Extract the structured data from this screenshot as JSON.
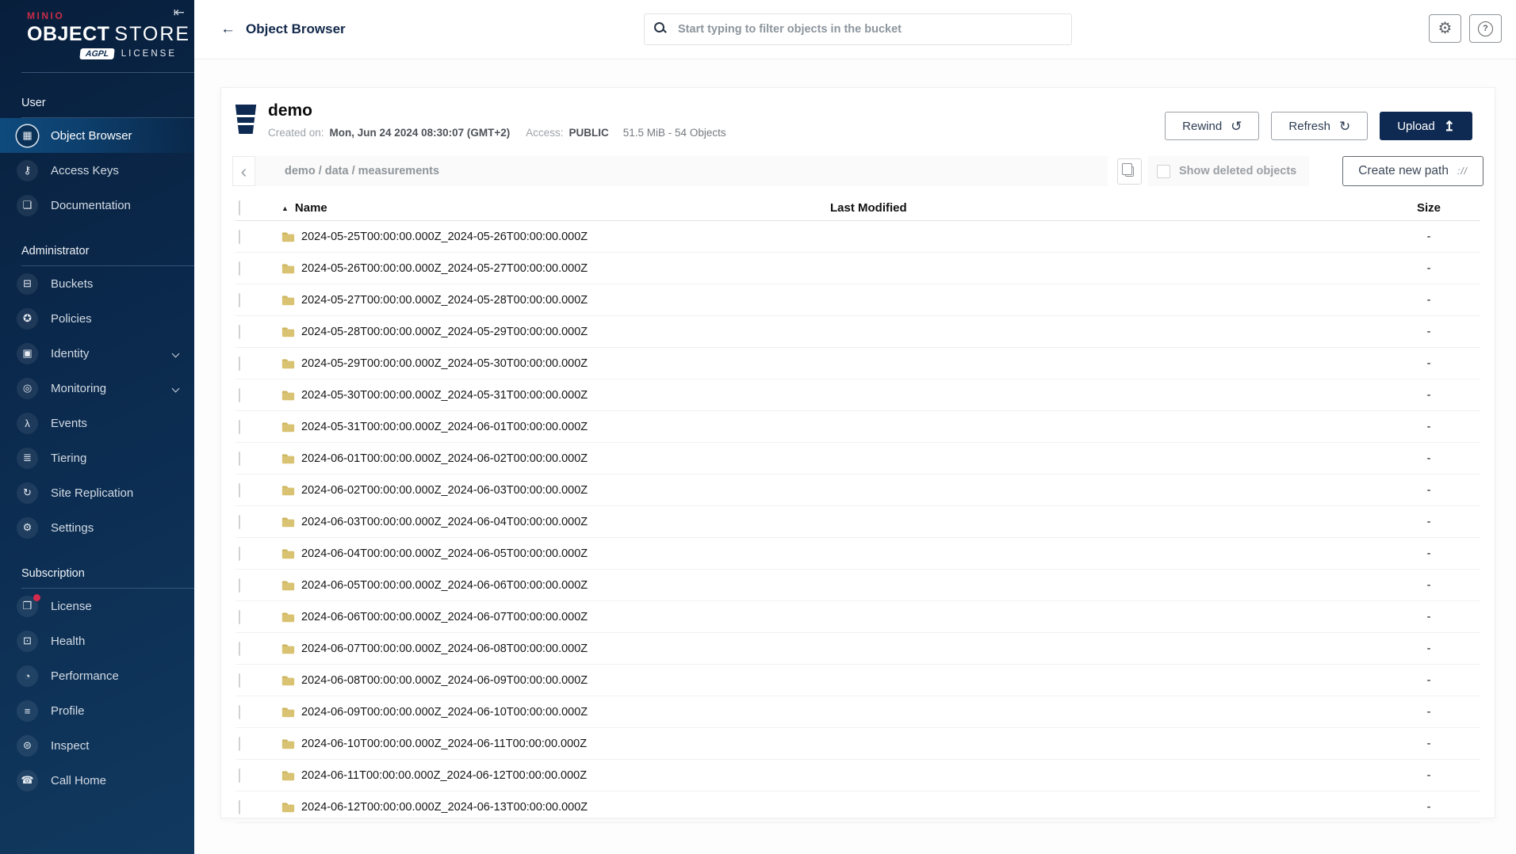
{
  "logo": {
    "brand": "MINIO",
    "word_primary": "OBJECT",
    "word_secondary": "STORE",
    "badge": "AGPL",
    "license_label": "LICENSE",
    "collapse_glyph": "⇤"
  },
  "app": {
    "header_title": "Object Browser",
    "back_glyph": "←",
    "search_placeholder": "Start typing to filter objects in the bucket",
    "gear_glyph": "⚙",
    "help_glyph": "?"
  },
  "sidebar": {
    "sections": {
      "user": {
        "label": "User",
        "items": [
          {
            "id": "sidebar-item-object-browser",
            "icon_name": "object-browser-icon",
            "glyph": "▦",
            "label": "Object Browser",
            "active": true
          },
          {
            "id": "sidebar-item-access-keys",
            "icon_name": "access-keys-icon",
            "glyph": "⚷",
            "label": "Access Keys"
          },
          {
            "id": "sidebar-item-documentation",
            "icon_name": "documentation-icon",
            "glyph": "❏",
            "label": "Documentation"
          }
        ]
      },
      "administrator": {
        "label": "Administrator",
        "items": [
          {
            "id": "sidebar-item-buckets",
            "icon_name": "buckets-icon",
            "glyph": "⊟",
            "label": "Buckets"
          },
          {
            "id": "sidebar-item-policies",
            "icon_name": "policies-icon",
            "glyph": "✪",
            "label": "Policies"
          },
          {
            "id": "sidebar-item-identity",
            "icon_name": "identity-icon",
            "glyph": "▣",
            "label": "Identity",
            "has_submenu": true
          },
          {
            "id": "sidebar-item-monitoring",
            "icon_name": "monitoring-icon",
            "glyph": "◎",
            "label": "Monitoring",
            "has_submenu": true
          },
          {
            "id": "sidebar-item-events",
            "icon_name": "events-icon",
            "glyph": "λ",
            "label": "Events"
          },
          {
            "id": "sidebar-item-tiering",
            "icon_name": "tiering-icon",
            "glyph": "≣",
            "label": "Tiering"
          },
          {
            "id": "sidebar-item-site-replication",
            "icon_name": "site-replication-icon",
            "glyph": "↻",
            "label": "Site Replication"
          },
          {
            "id": "sidebar-item-settings",
            "icon_name": "settings-icon",
            "glyph": "⚙",
            "label": "Settings"
          }
        ]
      },
      "subscription": {
        "label": "Subscription",
        "items": [
          {
            "id": "sidebar-item-license",
            "icon_name": "license-icon",
            "glyph": "❒",
            "label": "License",
            "badge": true
          },
          {
            "id": "sidebar-item-health",
            "icon_name": "health-icon",
            "glyph": "⊡",
            "label": "Health"
          },
          {
            "id": "sidebar-item-performance",
            "icon_name": "performance-icon",
            "glyph": "◔",
            "label": "Performance"
          },
          {
            "id": "sidebar-item-profile",
            "icon_name": "profile-icon",
            "glyph": "≡",
            "label": "Profile"
          },
          {
            "id": "sidebar-item-inspect",
            "icon_name": "inspect-icon",
            "glyph": "⊜",
            "label": "Inspect"
          },
          {
            "id": "sidebar-item-call-home",
            "icon_name": "call-home-icon",
            "glyph": "☎",
            "label": "Call Home"
          }
        ]
      }
    }
  },
  "bucket": {
    "name": "demo",
    "created_label": "Created on:",
    "created_value": "Mon, Jun 24 2024 08:30:07 (GMT+2)",
    "access_label": "Access:",
    "access_value": "PUBLIC",
    "usage": "51.5 MiB - 54 Objects",
    "rewind_label": "Rewind",
    "rewind_glyph": "↺",
    "refresh_label": "Refresh",
    "refresh_glyph": "↻",
    "upload_label": "Upload",
    "upload_glyph": "↥"
  },
  "browser_bar": {
    "back_glyph": "‹",
    "breadcrumb": "demo / data / measurements",
    "show_deleted_label": "Show deleted objects",
    "create_path_label": "Create new path",
    "create_path_glyph": "://"
  },
  "table": {
    "columns": {
      "name": "Name",
      "last_modified": "Last Modified",
      "size": "Size"
    },
    "sort_glyph": "▲",
    "rows": [
      {
        "name": "2024-05-25T00:00:00.000Z_2024-05-26T00:00:00.000Z",
        "last_modified": "",
        "size": "-"
      },
      {
        "name": "2024-05-26T00:00:00.000Z_2024-05-27T00:00:00.000Z",
        "last_modified": "",
        "size": "-"
      },
      {
        "name": "2024-05-27T00:00:00.000Z_2024-05-28T00:00:00.000Z",
        "last_modified": "",
        "size": "-"
      },
      {
        "name": "2024-05-28T00:00:00.000Z_2024-05-29T00:00:00.000Z",
        "last_modified": "",
        "size": "-"
      },
      {
        "name": "2024-05-29T00:00:00.000Z_2024-05-30T00:00:00.000Z",
        "last_modified": "",
        "size": "-"
      },
      {
        "name": "2024-05-30T00:00:00.000Z_2024-05-31T00:00:00.000Z",
        "last_modified": "",
        "size": "-"
      },
      {
        "name": "2024-05-31T00:00:00.000Z_2024-06-01T00:00:00.000Z",
        "last_modified": "",
        "size": "-"
      },
      {
        "name": "2024-06-01T00:00:00.000Z_2024-06-02T00:00:00.000Z",
        "last_modified": "",
        "size": "-"
      },
      {
        "name": "2024-06-02T00:00:00.000Z_2024-06-03T00:00:00.000Z",
        "last_modified": "",
        "size": "-"
      },
      {
        "name": "2024-06-03T00:00:00.000Z_2024-06-04T00:00:00.000Z",
        "last_modified": "",
        "size": "-"
      },
      {
        "name": "2024-06-04T00:00:00.000Z_2024-06-05T00:00:00.000Z",
        "last_modified": "",
        "size": "-"
      },
      {
        "name": "2024-06-05T00:00:00.000Z_2024-06-06T00:00:00.000Z",
        "last_modified": "",
        "size": "-"
      },
      {
        "name": "2024-06-06T00:00:00.000Z_2024-06-07T00:00:00.000Z",
        "last_modified": "",
        "size": "-"
      },
      {
        "name": "2024-06-07T00:00:00.000Z_2024-06-08T00:00:00.000Z",
        "last_modified": "",
        "size": "-"
      },
      {
        "name": "2024-06-08T00:00:00.000Z_2024-06-09T00:00:00.000Z",
        "last_modified": "",
        "size": "-"
      },
      {
        "name": "2024-06-09T00:00:00.000Z_2024-06-10T00:00:00.000Z",
        "last_modified": "",
        "size": "-"
      },
      {
        "name": "2024-06-10T00:00:00.000Z_2024-06-11T00:00:00.000Z",
        "last_modified": "",
        "size": "-"
      },
      {
        "name": "2024-06-11T00:00:00.000Z_2024-06-12T00:00:00.000Z",
        "last_modified": "",
        "size": "-"
      },
      {
        "name": "2024-06-12T00:00:00.000Z_2024-06-13T00:00:00.000Z",
        "last_modified": "",
        "size": "-"
      }
    ]
  },
  "colors": {
    "accent_navy": "#0E2A52",
    "brand_red": "#C72C48",
    "license_badge_red": "#D5294D",
    "folder": "#D9C372"
  }
}
